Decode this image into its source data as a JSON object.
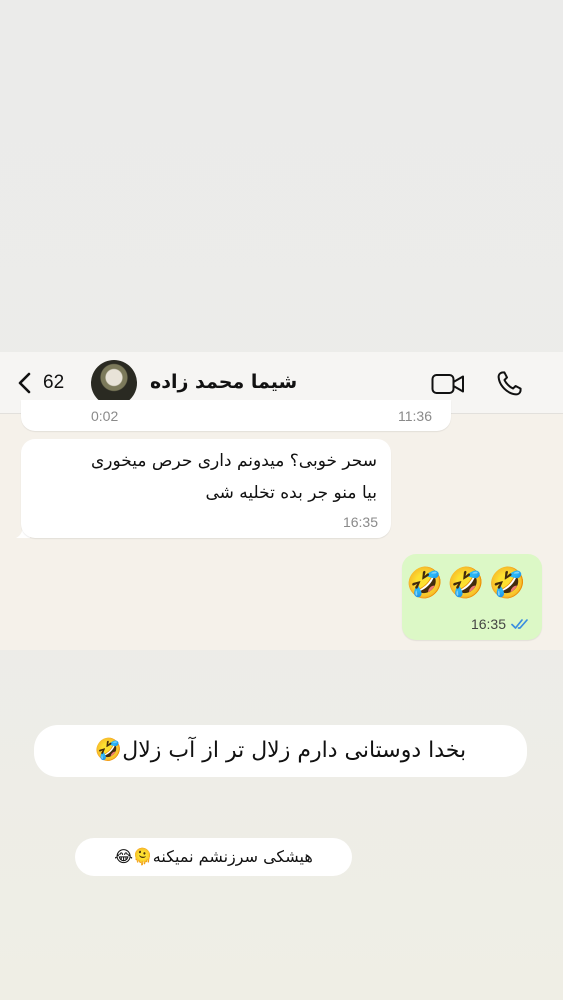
{
  "header": {
    "back_count": "62",
    "contact_name": "شیما محمد زاده",
    "icons": [
      "chevron-left-icon",
      "video-call-icon",
      "phone-icon"
    ]
  },
  "messages": {
    "partial": {
      "left_text": "0:02",
      "right_text": "11:36"
    },
    "incoming": {
      "line1": "سحر خوبی؟ میدونم داری حرص میخوری",
      "line2": "بیا منو جر بده تخلیه شی",
      "time": "16:35"
    },
    "outgoing": {
      "text": "🤣🤣🤣",
      "time": "16:35",
      "status_icon": "double-check-icon"
    }
  },
  "captions": {
    "line1": "بخدا دوستانی دارم زلال تر از آب زلال🤣",
    "line2": "هیشکی سرزنشم نمیکنه🫠😂"
  },
  "colors": {
    "outgoing_bubble": "#dcf8c6",
    "incoming_bubble": "#ffffff",
    "read_ticks": "#3a8de0",
    "chat_background": "#f5f1ea"
  }
}
